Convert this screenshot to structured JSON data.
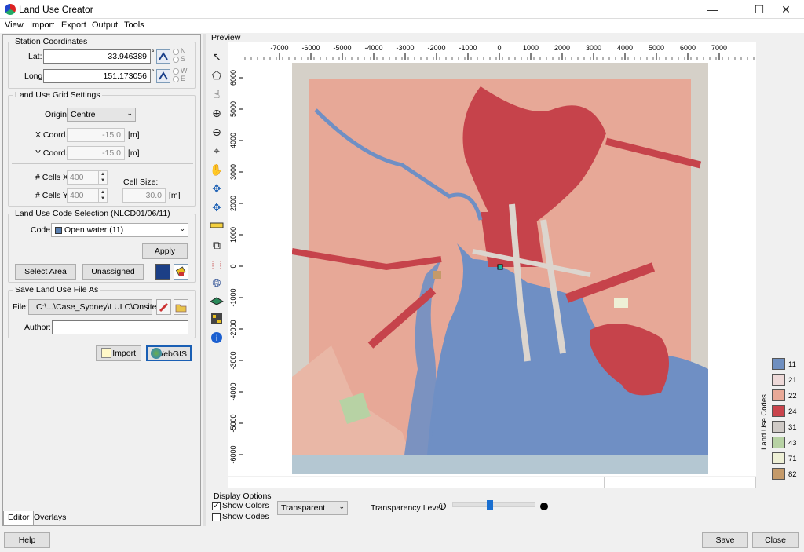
{
  "window": {
    "title": "Land Use Creator",
    "minimize": "—",
    "maximize": "☐",
    "close": "✕"
  },
  "menu": [
    "View",
    "Import",
    "Export",
    "Output",
    "Tools"
  ],
  "station": {
    "title": "Station Coordinates",
    "lat_label": "Lat:",
    "lat_value": "33.946389",
    "lat_dir1": "N",
    "lat_dir2": "S",
    "long_label": "Long:",
    "long_value": "151.173056",
    "long_dir1": "W",
    "long_dir2": "E",
    "degree": "°"
  },
  "grid": {
    "title": "Land Use Grid Settings",
    "origin_label": "Origin:",
    "origin_value": "Centre",
    "x_label": "X Coord.:",
    "x_value": "-15.0",
    "y_label": "Y Coord.:",
    "y_value": "-15.0",
    "unit": "[m]",
    "cellsx_label": "# Cells X:",
    "cellsx_value": "400",
    "cellsy_label": "# Cells Y:",
    "cellsy_value": "400",
    "cellsize_label": "Cell Size:",
    "cellsize_value": "30.0"
  },
  "code": {
    "title": "Land Use Code Selection (NLCD01/06/11)",
    "code_label": "Code:",
    "code_value": "Open water (11)",
    "code_color": "#5a7fb0",
    "apply": "Apply",
    "select_area": "Select Area",
    "unassigned": "Unassigned"
  },
  "save": {
    "title": "Save Land Use File As",
    "file_label": "File:",
    "file_value": "C:\\...\\Case_Sydney\\LULC\\Onsite.tif",
    "author_label": "Author:",
    "author_value": ""
  },
  "actions": {
    "import": "Import",
    "webgis": "WebGIS"
  },
  "tabs": [
    "Editor",
    "Overlays"
  ],
  "preview": {
    "label": "Preview",
    "x_ticks": [
      "-7000",
      "-6000",
      "-5000",
      "-4000",
      "-3000",
      "-2000",
      "-1000",
      "0",
      "1000",
      "2000",
      "3000",
      "4000",
      "5000",
      "6000",
      "7000"
    ],
    "y_ticks": [
      "6000",
      "5000",
      "4000",
      "3000",
      "2000",
      "1000",
      "0",
      "-1000",
      "-2000",
      "-3000",
      "-4000",
      "-5000",
      "-6000"
    ]
  },
  "legend": {
    "title": "Land Use Codes",
    "items": [
      {
        "code": "11",
        "color": "#6f8fc0"
      },
      {
        "code": "21",
        "color": "#eed9d8"
      },
      {
        "code": "22",
        "color": "#e9a997"
      },
      {
        "code": "24",
        "color": "#c9444c"
      },
      {
        "code": "31",
        "color": "#cfcac6"
      },
      {
        "code": "43",
        "color": "#b7d2a4"
      },
      {
        "code": "71",
        "color": "#eef0d6"
      },
      {
        "code": "82",
        "color": "#c49a6a"
      }
    ]
  },
  "display": {
    "title": "Display Options",
    "show_colors": "Show Colors",
    "show_codes": "Show Codes",
    "mode": "Transparent",
    "transparency_label": "Transparency Level:",
    "transparency": 0.45
  },
  "footer": {
    "help": "Help",
    "save": "Save",
    "close": "Close"
  }
}
